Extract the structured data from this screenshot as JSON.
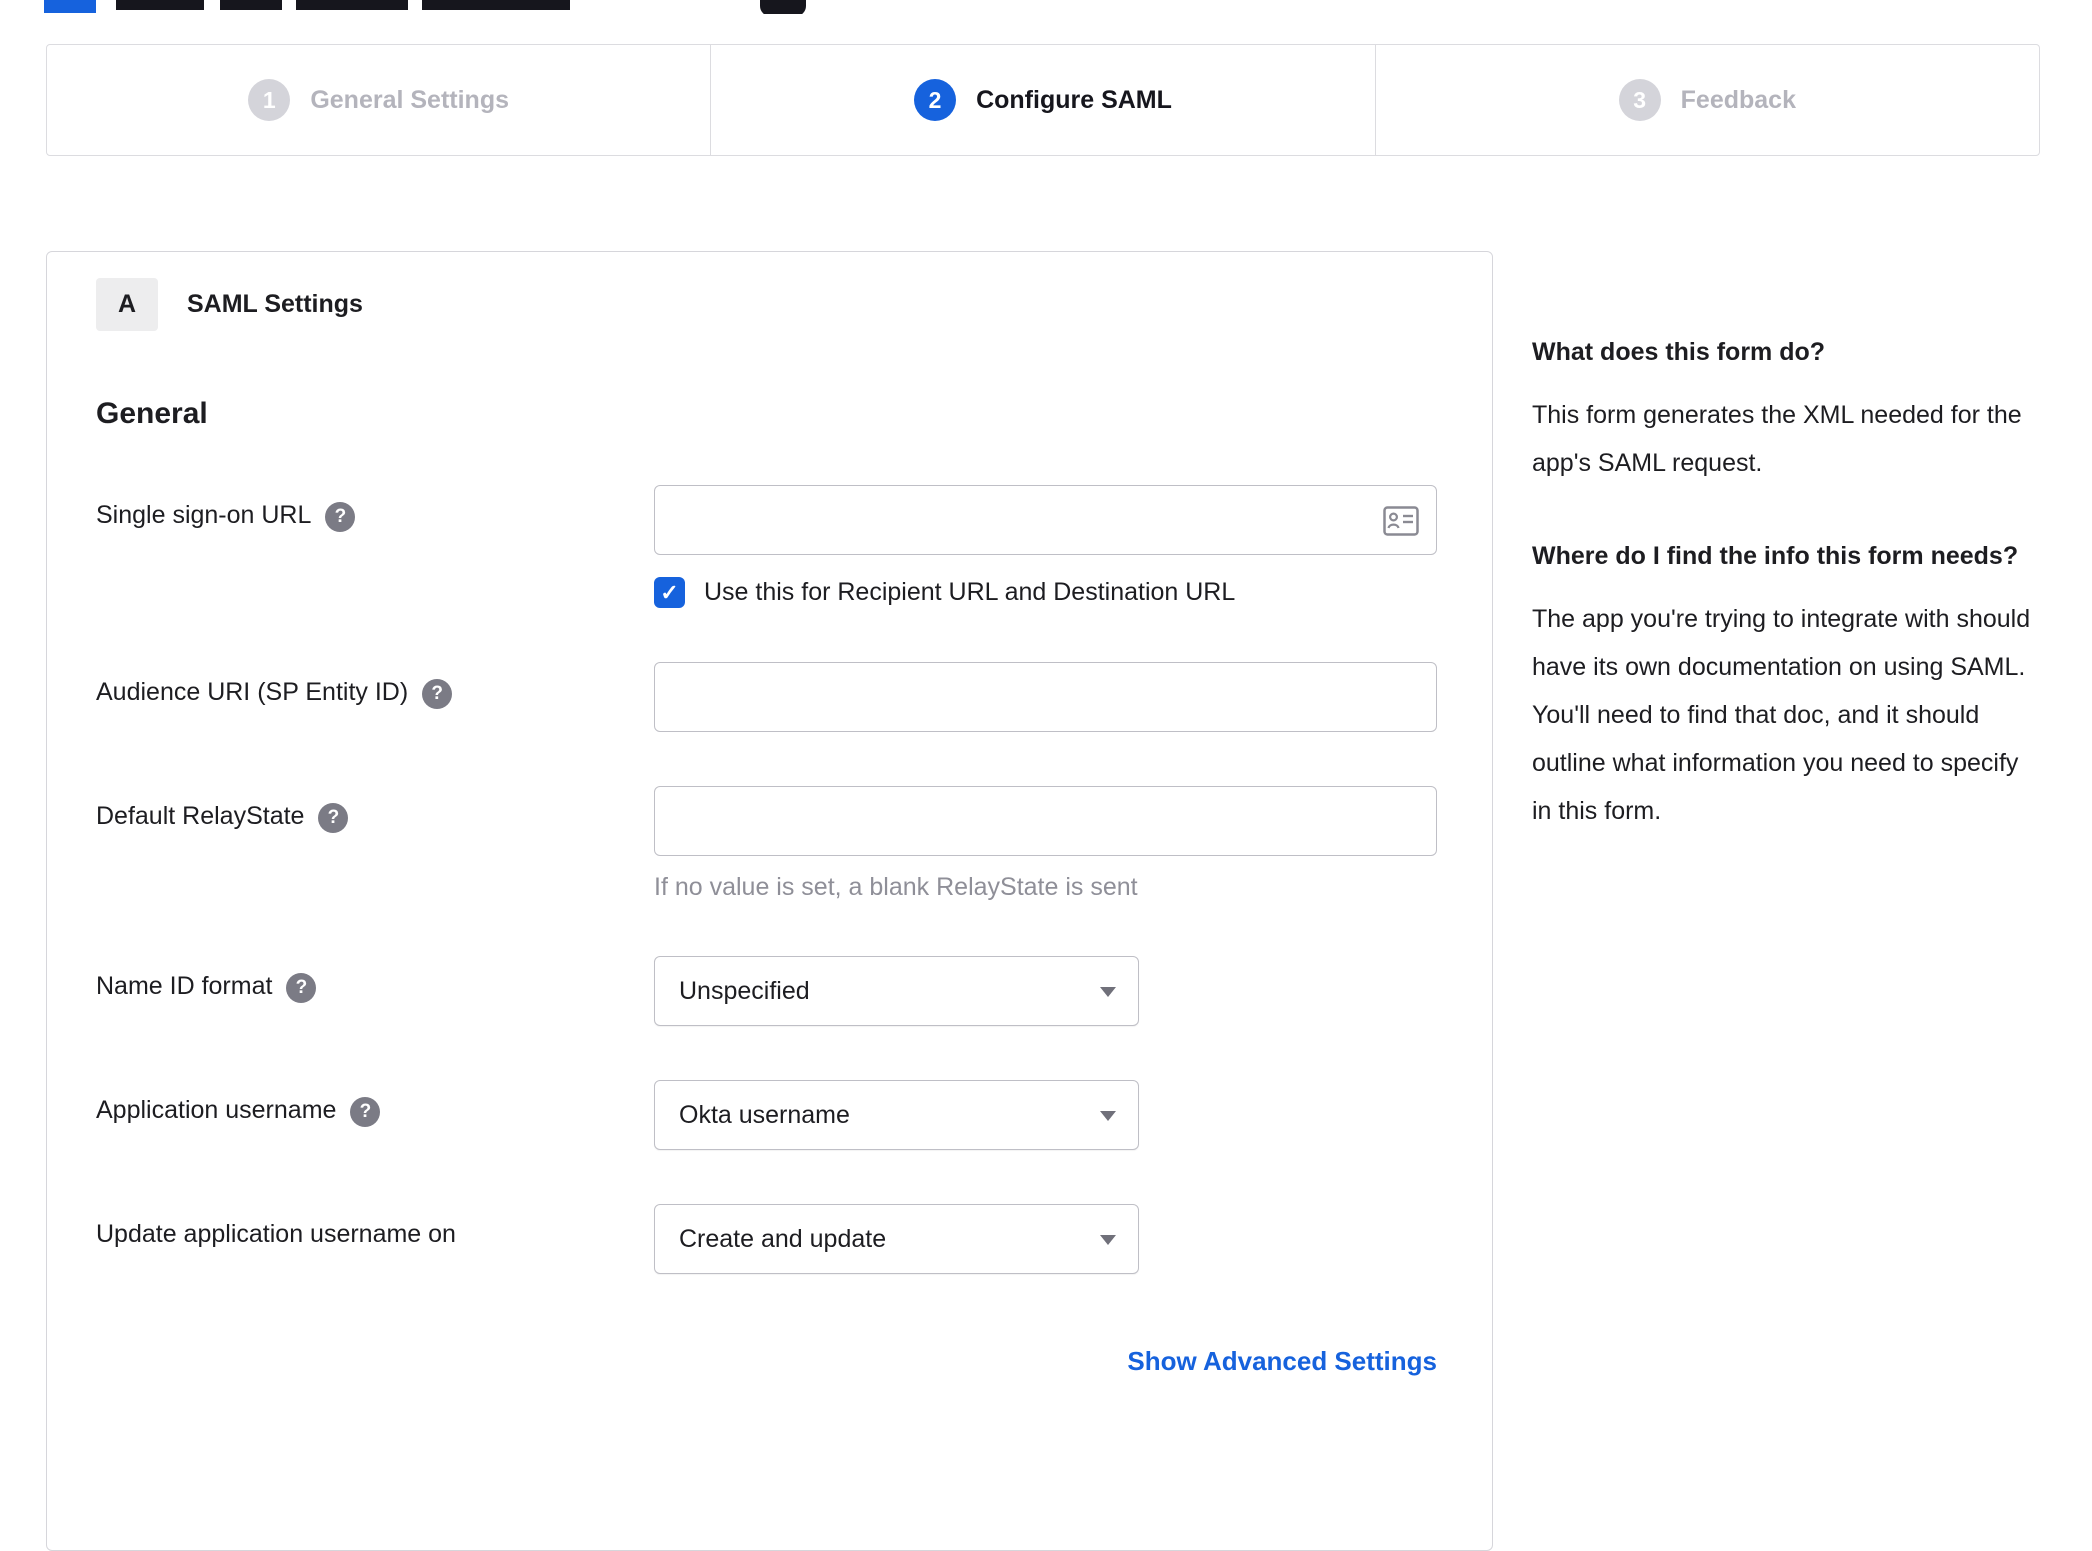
{
  "accent_color": "#1662dd",
  "wizard": {
    "steps": [
      {
        "number": "1",
        "label": "General Settings"
      },
      {
        "number": "2",
        "label": "Configure SAML"
      },
      {
        "number": "3",
        "label": "Feedback"
      }
    ],
    "active_step": "2"
  },
  "panel": {
    "section_badge": "A",
    "section_title": "SAML Settings",
    "group_title": "General",
    "fields": {
      "sso": {
        "label": "Single sign-on URL",
        "value": "",
        "checkbox_checked": true,
        "checkbox_label": "Use this for Recipient URL and Destination URL"
      },
      "audience": {
        "label": "Audience URI (SP Entity ID)",
        "value": ""
      },
      "relay": {
        "label": "Default RelayState",
        "value": "",
        "hint": "If no value is set, a blank RelayState is sent"
      },
      "nameid": {
        "label": "Name ID format",
        "value": "Unspecified"
      },
      "appuser": {
        "label": "Application username",
        "value": "Okta username"
      },
      "updateuser": {
        "label": "Update application username on",
        "value": "Create and update"
      }
    },
    "advanced_link": "Show Advanced Settings"
  },
  "sidebar": {
    "blocks": [
      {
        "heading": "What does this form do?",
        "body": "This form generates the XML needed for the app's SAML request."
      },
      {
        "heading": "Where do I find the info this form needs?",
        "body": "The app you're trying to integrate with should have its own documentation on using SAML. You'll need to find that doc, and it should outline what information you need to specify in this form."
      }
    ]
  }
}
